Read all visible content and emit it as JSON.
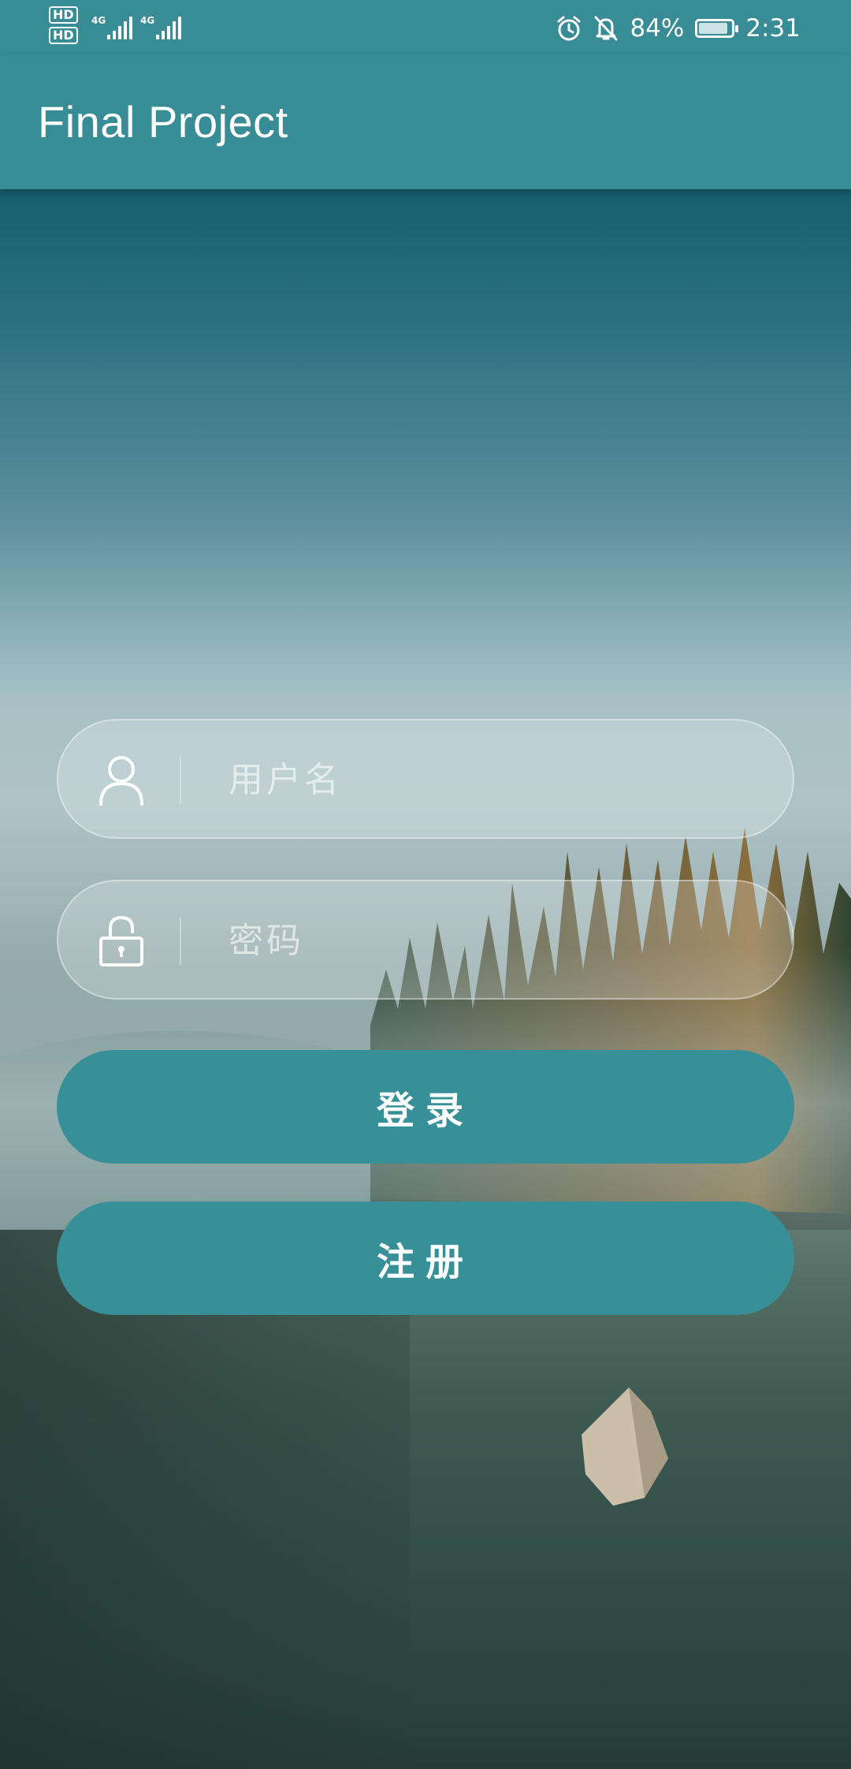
{
  "status_bar": {
    "sim1": "HD",
    "sim2": "HD",
    "network1": "4G",
    "network2": "4G",
    "battery": "84%",
    "time": "2:31",
    "icons": [
      "alarm-icon",
      "bell-off-icon",
      "battery-icon"
    ]
  },
  "app_bar": {
    "title": "Final Project"
  },
  "login_form": {
    "username_placeholder": "用户名",
    "password_placeholder": "密码",
    "login_label": "登录",
    "register_label": "注册"
  },
  "colors": {
    "primary": "#378c96",
    "button": "#378f98"
  }
}
